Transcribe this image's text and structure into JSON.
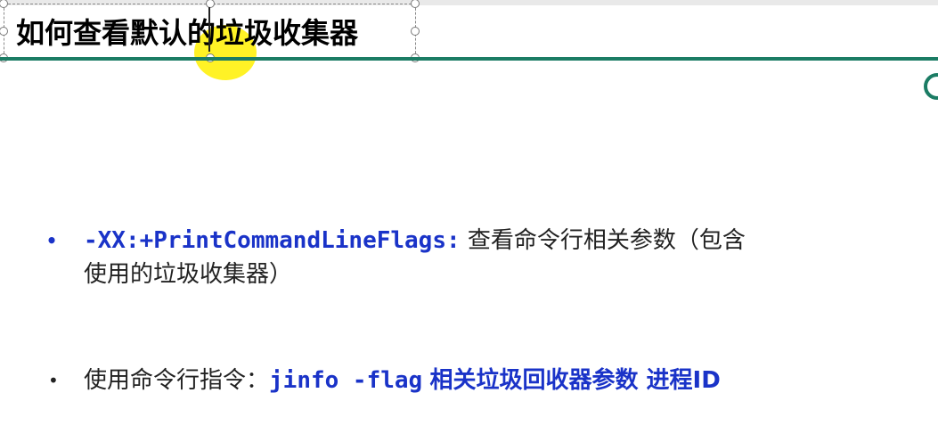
{
  "slide": {
    "title": "如何查看默认的垃圾收集器",
    "bullets": [
      {
        "code": "-XX:+PrintCommandLineFlags:",
        "text_line1": "查看命令行相关参数（包含",
        "text_line2": "使用的垃圾收集器）"
      },
      {
        "prefix": "使用命令行指令：",
        "command": "jinfo -flag",
        "highlight": "相关垃圾回收器参数 进程ID"
      }
    ],
    "bullet_symbol": "•"
  },
  "colors": {
    "accent_line": "#1b7c64",
    "code_blue": "#1a33c8",
    "cursor_highlight": "#fff000"
  }
}
